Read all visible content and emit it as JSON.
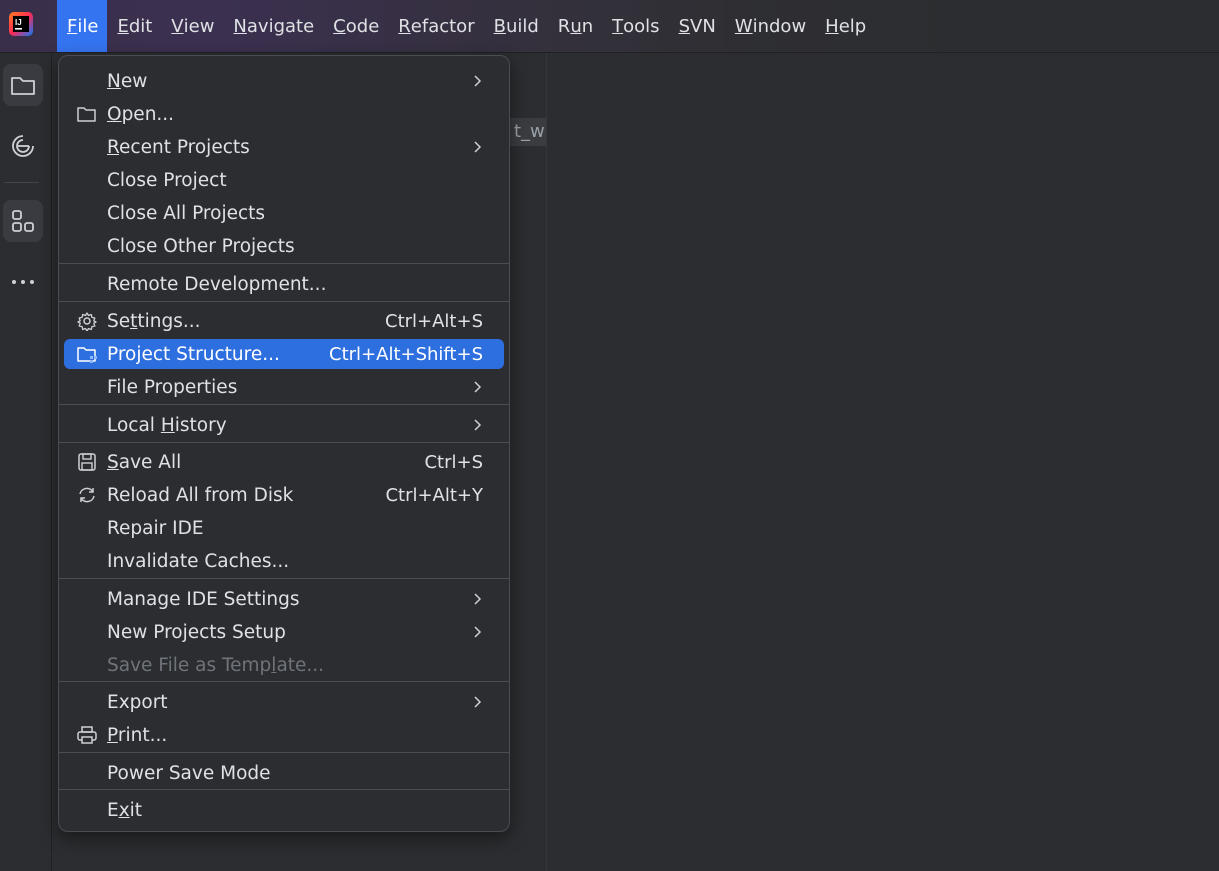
{
  "colors": {
    "accent": "#3574f0",
    "highlight": "#2e6fe0",
    "background": "#2b2d30",
    "text": "#dfe1e5",
    "disabled_text": "#6f737a"
  },
  "menubar": {
    "items": [
      {
        "pre": "",
        "u": "F",
        "post": "ile"
      },
      {
        "pre": "",
        "u": "E",
        "post": "dit"
      },
      {
        "pre": "",
        "u": "V",
        "post": "iew"
      },
      {
        "pre": "",
        "u": "N",
        "post": "avigate"
      },
      {
        "pre": "",
        "u": "C",
        "post": "ode"
      },
      {
        "pre": "",
        "u": "R",
        "post": "efactor"
      },
      {
        "pre": "",
        "u": "B",
        "post": "uild"
      },
      {
        "pre": "R",
        "u": "u",
        "post": "n"
      },
      {
        "pre": "",
        "u": "T",
        "post": "ools"
      },
      {
        "pre": "",
        "u": "S",
        "post": "VN"
      },
      {
        "pre": "",
        "u": "W",
        "post": "indow"
      },
      {
        "pre": "",
        "u": "H",
        "post": "elp"
      }
    ],
    "active_index": 0
  },
  "toolstrip": {
    "icons": [
      "project-folder-icon",
      "ai-assistant-icon",
      "structure-icon",
      "more-icon"
    ]
  },
  "editor": {
    "partial_tab_text": "t_w"
  },
  "file_menu": {
    "items": [
      {
        "pre": "",
        "u": "N",
        "post": "ew",
        "icon": "",
        "shortcut": "",
        "submenu": true
      },
      {
        "pre": "",
        "u": "O",
        "post": "pen...",
        "icon": "folder-icon",
        "shortcut": "",
        "submenu": false
      },
      {
        "pre": "",
        "u": "R",
        "post": "ecent Projects",
        "icon": "",
        "shortcut": "",
        "submenu": true
      },
      {
        "pre": "Close Pro",
        "u": "j",
        "post": "ect",
        "icon": "",
        "shortcut": "",
        "submenu": false
      },
      {
        "pre": "Close All Projects",
        "u": "",
        "post": "",
        "icon": "",
        "shortcut": "",
        "submenu": false
      },
      {
        "pre": "Close Other Projects",
        "u": "",
        "post": "",
        "icon": "",
        "shortcut": "",
        "submenu": false
      },
      {
        "pre": "Remote Development...",
        "u": "",
        "post": "",
        "icon": "",
        "shortcut": "",
        "submenu": false
      },
      {
        "pre": "Se",
        "u": "t",
        "post": "tings...",
        "icon": "gear-icon",
        "shortcut": "Ctrl+Alt+S",
        "submenu": false
      },
      {
        "pre": "Project Structure...",
        "u": "",
        "post": "",
        "icon": "project-structure-icon",
        "shortcut": "Ctrl+Alt+Shift+S",
        "submenu": false,
        "highlighted": true
      },
      {
        "pre": "File Properties",
        "u": "",
        "post": "",
        "icon": "",
        "shortcut": "",
        "submenu": true
      },
      {
        "pre": "Local ",
        "u": "H",
        "post": "istory",
        "icon": "",
        "shortcut": "",
        "submenu": true
      },
      {
        "pre": "",
        "u": "S",
        "post": "ave All",
        "icon": "save-icon",
        "shortcut": "Ctrl+S",
        "submenu": false
      },
      {
        "pre": "Reload All from Disk",
        "u": "",
        "post": "",
        "icon": "reload-icon",
        "shortcut": "Ctrl+Alt+Y",
        "submenu": false
      },
      {
        "pre": "Repair IDE",
        "u": "",
        "post": "",
        "icon": "",
        "shortcut": "",
        "submenu": false
      },
      {
        "pre": "Invalidate Caches...",
        "u": "",
        "post": "",
        "icon": "",
        "shortcut": "",
        "submenu": false
      },
      {
        "pre": "Manage IDE Settings",
        "u": "",
        "post": "",
        "icon": "",
        "shortcut": "",
        "submenu": true
      },
      {
        "pre": "New Projects Setup",
        "u": "",
        "post": "",
        "icon": "",
        "shortcut": "",
        "submenu": true
      },
      {
        "pre": "Save File as Temp",
        "u": "l",
        "post": "ate...",
        "icon": "",
        "shortcut": "",
        "submenu": false,
        "disabled": true
      },
      {
        "pre": "Export",
        "u": "",
        "post": "",
        "icon": "",
        "shortcut": "",
        "submenu": true
      },
      {
        "pre": "",
        "u": "P",
        "post": "rint...",
        "icon": "print-icon",
        "shortcut": "",
        "submenu": false
      },
      {
        "pre": "Power Save Mode",
        "u": "",
        "post": "",
        "icon": "",
        "shortcut": "",
        "submenu": false
      },
      {
        "pre": "E",
        "u": "x",
        "post": "it",
        "icon": "",
        "shortcut": "",
        "submenu": false
      }
    ]
  }
}
